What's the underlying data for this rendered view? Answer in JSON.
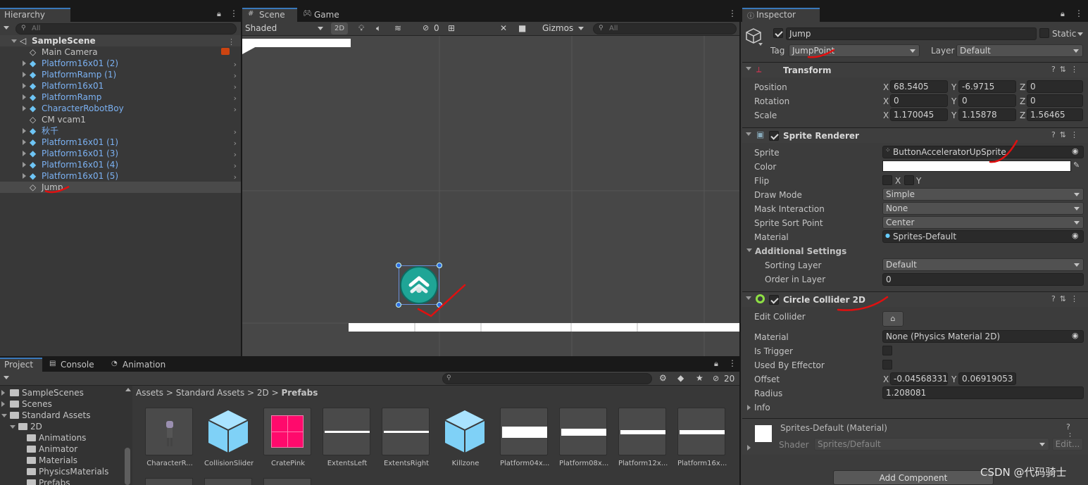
{
  "hierarchy": {
    "tab": "Hierarchy",
    "search_placeholder": "All",
    "scene": "SampleScene",
    "items": [
      {
        "label": "Main Camera",
        "prefab": false,
        "expandable": false
      },
      {
        "label": "Platform16x01 (2)",
        "prefab": true,
        "expandable": true
      },
      {
        "label": "PlatformRamp (1)",
        "prefab": true,
        "expandable": true
      },
      {
        "label": "Platform16x01",
        "prefab": true,
        "expandable": true
      },
      {
        "label": "PlatformRamp",
        "prefab": true,
        "expandable": true
      },
      {
        "label": "CharacterRobotBoy",
        "prefab": true,
        "expandable": true
      },
      {
        "label": "CM vcam1",
        "prefab": false,
        "expandable": false
      },
      {
        "label": "秋千",
        "prefab": true,
        "expandable": true
      },
      {
        "label": "Platform16x01 (1)",
        "prefab": true,
        "expandable": true
      },
      {
        "label": "Platform16x01 (3)",
        "prefab": true,
        "expandable": true
      },
      {
        "label": "Platform16x01 (4)",
        "prefab": true,
        "expandable": true
      },
      {
        "label": "Platform16x01 (5)",
        "prefab": true,
        "expandable": true
      },
      {
        "label": "Jump",
        "prefab": false,
        "expandable": false,
        "selected": true
      }
    ]
  },
  "scene_view": {
    "tabs": [
      "Scene",
      "Game"
    ],
    "shading": "Shaded",
    "mode_2d": "2D",
    "hidden_count": "0",
    "gizmos": "Gizmos",
    "search_placeholder": "All"
  },
  "inspector": {
    "tab": "Inspector",
    "object_name": "Jump",
    "static_label": "Static",
    "tag_label": "Tag",
    "tag_value": "JumpPoint",
    "layer_label": "Layer",
    "layer_value": "Default",
    "transform": {
      "title": "Transform",
      "position_label": "Position",
      "rotation_label": "Rotation",
      "scale_label": "Scale",
      "position": {
        "x": "68.5405",
        "y": "-6.9715",
        "z": "0"
      },
      "rotation": {
        "x": "0",
        "y": "0",
        "z": "0"
      },
      "scale": {
        "x": "1.170045",
        "y": "1.15878",
        "z": "1.56465"
      }
    },
    "sprite_renderer": {
      "title": "Sprite Renderer",
      "sprite_label": "Sprite",
      "sprite_value": "ButtonAcceleratorUpSprite",
      "color_label": "Color",
      "flip_label": "Flip",
      "flip_x": "X",
      "flip_y": "Y",
      "draw_mode_label": "Draw Mode",
      "draw_mode_value": "Simple",
      "mask_label": "Mask Interaction",
      "mask_value": "None",
      "sort_point_label": "Sprite Sort Point",
      "sort_point_value": "Center",
      "material_label": "Material",
      "material_value": "Sprites-Default",
      "additional_label": "Additional Settings",
      "sorting_layer_label": "Sorting Layer",
      "sorting_layer_value": "Default",
      "order_label": "Order in Layer",
      "order_value": "0"
    },
    "circle_collider": {
      "title": "Circle Collider 2D",
      "edit_label": "Edit Collider",
      "material_label": "Material",
      "material_value": "None (Physics Material 2D)",
      "trigger_label": "Is Trigger",
      "effector_label": "Used By Effector",
      "offset_label": "Offset",
      "offset_x": "-0.04568331",
      "offset_y": "0.06919053",
      "radius_label": "Radius",
      "radius_value": "1.208081",
      "info_label": "Info"
    },
    "material_block": {
      "name": "Sprites-Default (Material)",
      "shader_label": "Shader",
      "shader_value": "Sprites/Default",
      "edit_label": "Edit..."
    },
    "add_component": "Add Component"
  },
  "project": {
    "tabs": [
      "Project",
      "Console",
      "Animation"
    ],
    "asset_count": "20",
    "tree": [
      {
        "label": "SampleScenes",
        "indent": 1
      },
      {
        "label": "Scenes",
        "indent": 1
      },
      {
        "label": "Standard Assets",
        "indent": 1
      },
      {
        "label": "2D",
        "indent": 2
      },
      {
        "label": "Animations",
        "indent": 3
      },
      {
        "label": "Animator",
        "indent": 3
      },
      {
        "label": "Materials",
        "indent": 3
      },
      {
        "label": "PhysicsMaterials",
        "indent": 3
      },
      {
        "label": "Prefabs",
        "indent": 3
      }
    ],
    "breadcrumb": [
      "Assets",
      "Standard Assets",
      "2D",
      "Prefabs"
    ],
    "assets": [
      {
        "name": "CharacterR...",
        "kind": "robot"
      },
      {
        "name": "CollisionSlider",
        "kind": "cube"
      },
      {
        "name": "CratePink",
        "kind": "crate"
      },
      {
        "name": "ExtentsLeft",
        "kind": "line"
      },
      {
        "name": "ExtentsRight",
        "kind": "line"
      },
      {
        "name": "Killzone",
        "kind": "cube"
      },
      {
        "name": "Platform04x...",
        "kind": "bar-thick"
      },
      {
        "name": "Platform08x...",
        "kind": "bar-mid"
      },
      {
        "name": "Platform12x...",
        "kind": "bar-thin"
      },
      {
        "name": "Platform16x...",
        "kind": "bar-thin"
      }
    ]
  },
  "watermark": "CSDN @代码骑士",
  "colors": {
    "accent": "#3a79bb",
    "prefab_text": "#7bb1f2",
    "annotation_red": "#e01010",
    "sprite_teal": "#1fa596"
  }
}
